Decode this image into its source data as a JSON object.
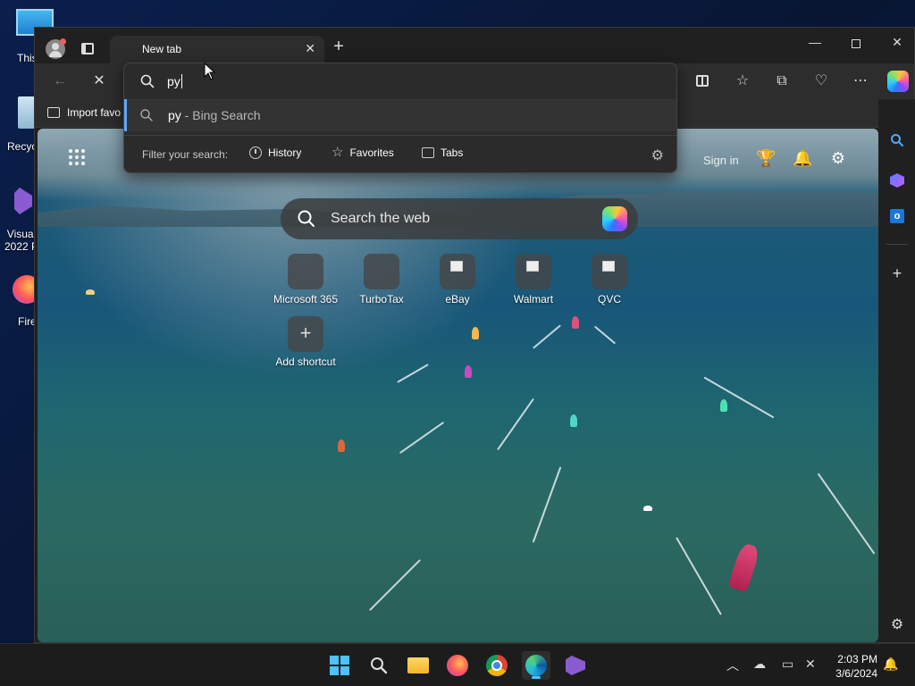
{
  "desktop": {
    "icons": [
      {
        "label": "This"
      },
      {
        "label": "Recyc"
      },
      {
        "label": "Visual\n2022 P"
      },
      {
        "label": "Fire"
      }
    ]
  },
  "browser": {
    "tab_title": "New tab",
    "favorites_bar": {
      "import_label": "Import favo"
    },
    "omnibox": {
      "query": "py",
      "suggestion_term": "py",
      "suggestion_suffix": " - Bing Search",
      "filter_label": "Filter your search:",
      "filters": [
        "History",
        "Favorites",
        "Tabs"
      ]
    }
  },
  "ntp": {
    "signin_label": "Sign in",
    "search_placeholder": "Search the web",
    "shortcuts": [
      {
        "label": "Microsoft 365"
      },
      {
        "label": "TurboTax"
      },
      {
        "label": "eBay"
      },
      {
        "label": "Walmart"
      },
      {
        "label": "QVC"
      }
    ],
    "add_shortcut_label": "Add shortcut"
  },
  "taskbar": {
    "time": "2:03 PM",
    "date": "3/6/2024"
  },
  "colors": {
    "accent": "#60a5fa",
    "taskbar_indicator": "#4cc2ff"
  }
}
